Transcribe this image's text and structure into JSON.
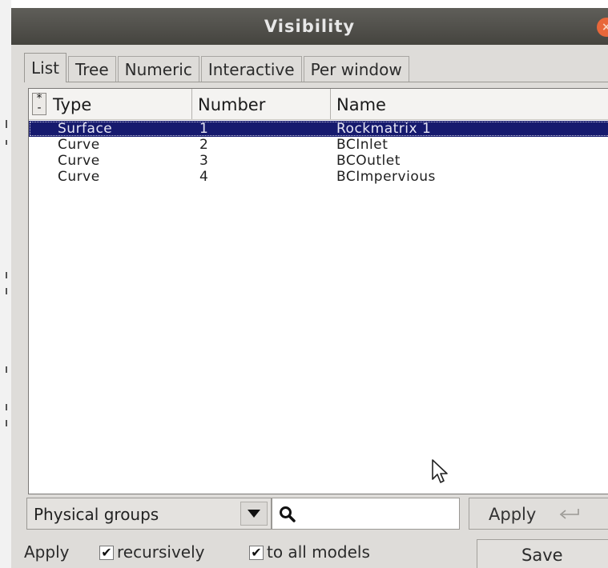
{
  "window": {
    "title": "Visibility",
    "close_symbol": "×"
  },
  "tabs": [
    {
      "label": "List",
      "active": true
    },
    {
      "label": "Tree",
      "active": false
    },
    {
      "label": "Numeric",
      "active": false
    },
    {
      "label": "Interactive",
      "active": false
    },
    {
      "label": "Per window",
      "active": false
    }
  ],
  "browser": {
    "sort_toggle": "*\n-",
    "columns": [
      "Type",
      "Number",
      "Name"
    ],
    "rows": [
      {
        "type": "Surface",
        "number": "1",
        "name": "Rockmatrix 1",
        "selected": true
      },
      {
        "type": "Curve",
        "number": "2",
        "name": "BCInlet",
        "selected": false
      },
      {
        "type": "Curve",
        "number": "3",
        "name": "BCOutlet",
        "selected": false
      },
      {
        "type": "Curve",
        "number": "4",
        "name": "BCImpervious",
        "selected": false
      }
    ]
  },
  "filter": {
    "mode": "Physical groups",
    "search_value": "",
    "search_icon": "search-icon",
    "apply_label": "Apply",
    "apply_icon": "enter-icon"
  },
  "footer": {
    "apply_label": "Apply",
    "recursively_label": "recursively",
    "recursively_checked": true,
    "all_models_label": "to all models",
    "all_models_checked": true,
    "save_label": "Save"
  },
  "colors": {
    "selection": "#161a6e",
    "titlebar": "#4f4e49",
    "close_button": "#e8673a",
    "window_bg": "#dedcd9"
  }
}
